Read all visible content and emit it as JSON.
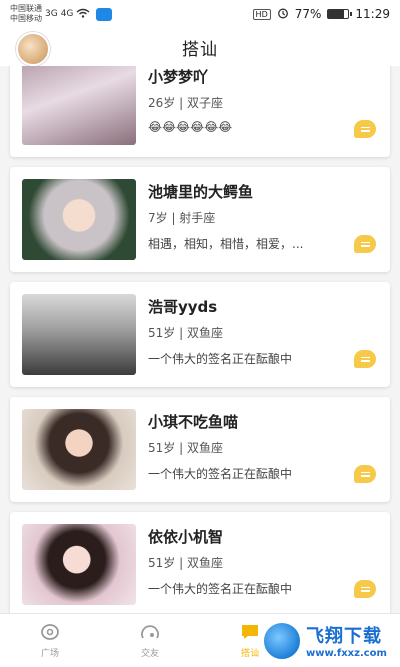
{
  "status_bar": {
    "carrier_1": "中国联通",
    "carrier_2": "中国移动",
    "signal_1": "3G",
    "signal_2": "4G",
    "hd": "HD",
    "battery_percent": "77%",
    "battery_level": 0.77,
    "time": "11:29"
  },
  "header": {
    "title": "搭讪"
  },
  "users": [
    {
      "name": "小梦梦吖",
      "meta": "26岁 | 双子座",
      "signature": "😂😂😂😂😂😂"
    },
    {
      "name": "池塘里的大鳄鱼",
      "meta": "7岁 | 射手座",
      "signature": "相遇，相知，相惜，相爱，..."
    },
    {
      "name": "浩哥yyds",
      "meta": "51岁 | 双鱼座",
      "signature": "一个伟大的签名正在酝酿中"
    },
    {
      "name": "小琪不吃鱼喵",
      "meta": "51岁 | 双鱼座",
      "signature": "一个伟大的签名正在酝酿中"
    },
    {
      "name": "依依小机智",
      "meta": "51岁 | 双鱼座",
      "signature": "一个伟大的签名正在酝酿中"
    }
  ],
  "tabs": [
    {
      "label": "广场",
      "icon": "plaza-icon"
    },
    {
      "label": "交友",
      "icon": "friends-icon"
    },
    {
      "label": "搭讪",
      "icon": "chat-icon"
    }
  ],
  "watermark": {
    "big": "飞翔下载",
    "small": "www.fxxz.com"
  },
  "colors": {
    "accent": "#f2b705",
    "chat_button": "#f7c948",
    "tab_inactive": "#999999"
  }
}
